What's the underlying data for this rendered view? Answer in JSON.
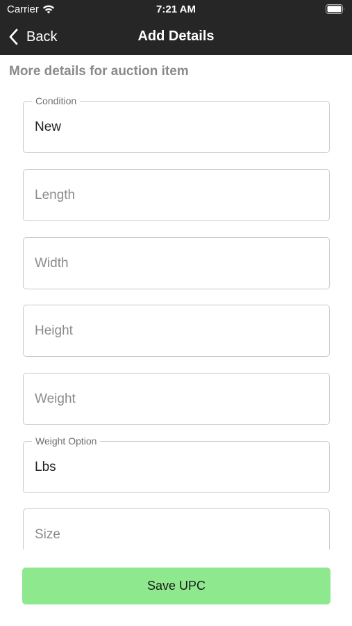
{
  "status_bar": {
    "carrier": "Carrier",
    "time": "7:21 AM",
    "wifi_icon": "wifi-icon",
    "battery_icon": "battery-icon"
  },
  "nav": {
    "back_label": "Back",
    "title": "Add Details",
    "back_icon": "chevron-left-icon"
  },
  "section_header": "More details for auction item",
  "fields": [
    {
      "label": "Condition",
      "value": "New",
      "placeholder": ""
    },
    {
      "label": "",
      "value": "",
      "placeholder": "Length"
    },
    {
      "label": "",
      "value": "",
      "placeholder": "Width"
    },
    {
      "label": "",
      "value": "",
      "placeholder": "Height"
    },
    {
      "label": "",
      "value": "",
      "placeholder": "Weight"
    },
    {
      "label": "Weight Option",
      "value": "Lbs",
      "placeholder": ""
    },
    {
      "label": "",
      "value": "",
      "placeholder": "Size"
    }
  ],
  "save_button": {
    "label": "Save UPC",
    "color": "#8ee88e"
  },
  "colors": {
    "header_bg": "#262626",
    "section_header_text": "#8a8a8a"
  }
}
